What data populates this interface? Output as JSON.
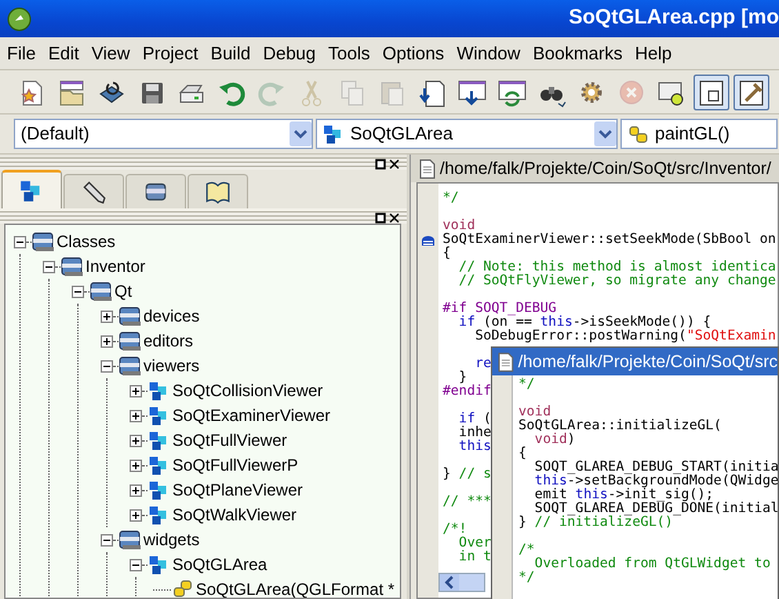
{
  "window": {
    "title": "SoQtGLArea.cpp [mo"
  },
  "menu": [
    "File",
    "Edit",
    "View",
    "Project",
    "Build",
    "Debug",
    "Tools",
    "Options",
    "Window",
    "Bookmarks",
    "Help"
  ],
  "toolbar": [
    {
      "disabled": false,
      "pressed": false
    },
    {
      "disabled": false,
      "pressed": false
    },
    {
      "disabled": false,
      "pressed": false
    },
    {
      "disabled": false,
      "pressed": false
    },
    {
      "disabled": false,
      "pressed": false
    },
    {
      "disabled": false,
      "pressed": false
    },
    {
      "disabled": true,
      "pressed": false
    },
    {
      "disabled": true,
      "pressed": false
    },
    {
      "disabled": true,
      "pressed": false
    },
    {
      "disabled": true,
      "pressed": false
    },
    {
      "disabled": false,
      "pressed": false
    },
    {
      "disabled": false,
      "pressed": false
    },
    {
      "disabled": false,
      "pressed": false
    },
    {
      "disabled": false,
      "pressed": false
    },
    {
      "disabled": false,
      "pressed": false
    },
    {
      "disabled": true,
      "pressed": false
    },
    {
      "disabled": false,
      "pressed": false
    },
    {
      "disabled": false,
      "pressed": true
    },
    {
      "disabled": false,
      "pressed": true
    }
  ],
  "selectors": [
    {
      "value": "(Default)"
    },
    {
      "value": "SoQtGLArea"
    },
    {
      "value": "paintGL()"
    }
  ],
  "side_tabs": [
    {
      "selected": true
    },
    {
      "selected": false
    },
    {
      "selected": false
    },
    {
      "selected": false
    }
  ],
  "tree": [
    {
      "label": "Classes",
      "kind": "folder",
      "expanded": true,
      "children": [
        {
          "label": "Inventor",
          "kind": "folder",
          "expanded": true,
          "children": [
            {
              "label": "Qt",
              "kind": "folder",
              "expanded": true,
              "children": [
                {
                  "label": "devices",
                  "kind": "folder",
                  "expanded": false
                },
                {
                  "label": "editors",
                  "kind": "folder",
                  "expanded": false
                },
                {
                  "label": "viewers",
                  "kind": "folder",
                  "expanded": true,
                  "children": [
                    {
                      "label": "SoQtCollisionViewer",
                      "kind": "class",
                      "expanded": false
                    },
                    {
                      "label": "SoQtExaminerViewer",
                      "kind": "class",
                      "expanded": false
                    },
                    {
                      "label": "SoQtFullViewer",
                      "kind": "class",
                      "expanded": false
                    },
                    {
                      "label": "SoQtFullViewerP",
                      "kind": "class",
                      "expanded": false
                    },
                    {
                      "label": "SoQtPlaneViewer",
                      "kind": "class",
                      "expanded": false
                    },
                    {
                      "label": "SoQtWalkViewer",
                      "kind": "class",
                      "expanded": false
                    }
                  ]
                },
                {
                  "label": "widgets",
                  "kind": "folder",
                  "expanded": true,
                  "children": [
                    {
                      "label": "SoQtGLArea",
                      "kind": "class",
                      "expanded": true,
                      "children": [
                        {
                          "label": "SoQtGLArea(QGLFormat *",
                          "kind": "method"
                        }
                      ]
                    }
                  ]
                }
              ]
            }
          ]
        }
      ]
    }
  ],
  "editor": {
    "path": "/home/falk/Projekte/Coin/SoQt/src/Inventor/",
    "lines": [
      {
        "segments": [
          {
            "text": "*/",
            "kind": "comment"
          }
        ]
      },
      {
        "space_before": true,
        "segments": [
          {
            "text": "void",
            "kind": "type"
          }
        ]
      },
      {
        "bookmark": true,
        "segments": [
          {
            "text": "SoQtExaminerViewer::setSeekMode(SbBool on",
            "kind": "plain"
          }
        ]
      },
      {
        "segments": [
          {
            "text": "{",
            "kind": "plain"
          }
        ]
      },
      {
        "segments": [
          {
            "text": "  // Note: this method is almost identica",
            "kind": "comment"
          }
        ]
      },
      {
        "segments": [
          {
            "text": "  // SoQtFlyViewer, so migrate any change",
            "kind": "comment"
          }
        ]
      },
      {
        "space_before": true,
        "segments": [
          {
            "text": "#if SOQT_DEBUG",
            "kind": "preproc"
          }
        ]
      },
      {
        "segments": [
          {
            "text": "  if",
            "kind": "keyword"
          },
          {
            "text": " (on == ",
            "kind": "plain"
          },
          {
            "text": "this",
            "kind": "keyword"
          },
          {
            "text": "->isSeekMode()) {",
            "kind": "plain"
          }
        ]
      },
      {
        "segments": [
          {
            "text": "    SoDebugError::postWarning(",
            "kind": "plain"
          },
          {
            "text": "\"SoQtExamin",
            "kind": "string"
          }
        ]
      },
      {
        "space_before": true,
        "segments": [
          {
            "text": "    re",
            "kind": "keyword"
          }
        ]
      },
      {
        "segments": [
          {
            "text": "  }",
            "kind": "plain"
          }
        ]
      },
      {
        "segments": [
          {
            "text": "#endif",
            "kind": "preproc"
          }
        ]
      },
      {
        "space_before": true,
        "segments": [
          {
            "text": "  if",
            "kind": "keyword"
          },
          {
            "text": " (",
            "kind": "plain"
          }
        ]
      },
      {
        "segments": [
          {
            "text": "  inhe",
            "kind": "plain"
          }
        ]
      },
      {
        "segments": [
          {
            "text": "  this",
            "kind": "keyword"
          }
        ]
      },
      {
        "space_before": true,
        "segments": [
          {
            "text": "} ",
            "kind": "plain"
          },
          {
            "text": "// s",
            "kind": "comment"
          }
        ]
      },
      {
        "space_before": true,
        "segments": [
          {
            "text": "// ***",
            "kind": "comment"
          }
        ]
      },
      {
        "space_before": true,
        "segments": [
          {
            "text": "/*!",
            "kind": "comment"
          }
        ]
      },
      {
        "segments": [
          {
            "text": "  Over",
            "kind": "comment"
          }
        ]
      },
      {
        "segments": [
          {
            "text": "  in t",
            "kind": "comment"
          }
        ]
      }
    ]
  },
  "popup": {
    "path": "/home/falk/Projekte/Coin/SoQt/src",
    "lines": [
      {
        "segments": [
          {
            "text": "*/",
            "kind": "comment"
          }
        ]
      },
      {
        "space_before": true,
        "segments": [
          {
            "text": "void",
            "kind": "type"
          }
        ]
      },
      {
        "segments": [
          {
            "text": "SoQtGLArea::initializeGL(",
            "kind": "plain"
          }
        ]
      },
      {
        "segments": [
          {
            "text": "  void",
            "kind": "type"
          },
          {
            "text": ")",
            "kind": "plain"
          }
        ]
      },
      {
        "segments": [
          {
            "text": "{",
            "kind": "plain"
          }
        ]
      },
      {
        "segments": [
          {
            "text": "  SOQT_GLAREA_DEBUG_START(initia",
            "kind": "plain"
          }
        ]
      },
      {
        "segments": [
          {
            "text": "  this",
            "kind": "keyword"
          },
          {
            "text": "->setBackgroundMode(QWidge",
            "kind": "plain"
          }
        ]
      },
      {
        "segments": [
          {
            "text": "  emit ",
            "kind": "plain"
          },
          {
            "text": "this",
            "kind": "keyword"
          },
          {
            "text": "->init_sig();",
            "kind": "plain"
          }
        ]
      },
      {
        "segments": [
          {
            "text": "  SOQT_GLAREA_DEBUG_DONE(initial",
            "kind": "plain"
          }
        ]
      },
      {
        "segments": [
          {
            "text": "} ",
            "kind": "plain"
          },
          {
            "text": "// initializeGL()",
            "kind": "comment"
          }
        ]
      },
      {
        "space_before": true,
        "segments": [
          {
            "text": "/*",
            "kind": "comment"
          }
        ]
      },
      {
        "segments": [
          {
            "text": "  Overloaded from QtGLWidget to",
            "kind": "comment"
          }
        ]
      },
      {
        "segments": [
          {
            "text": "*/",
            "kind": "comment"
          }
        ]
      }
    ]
  }
}
